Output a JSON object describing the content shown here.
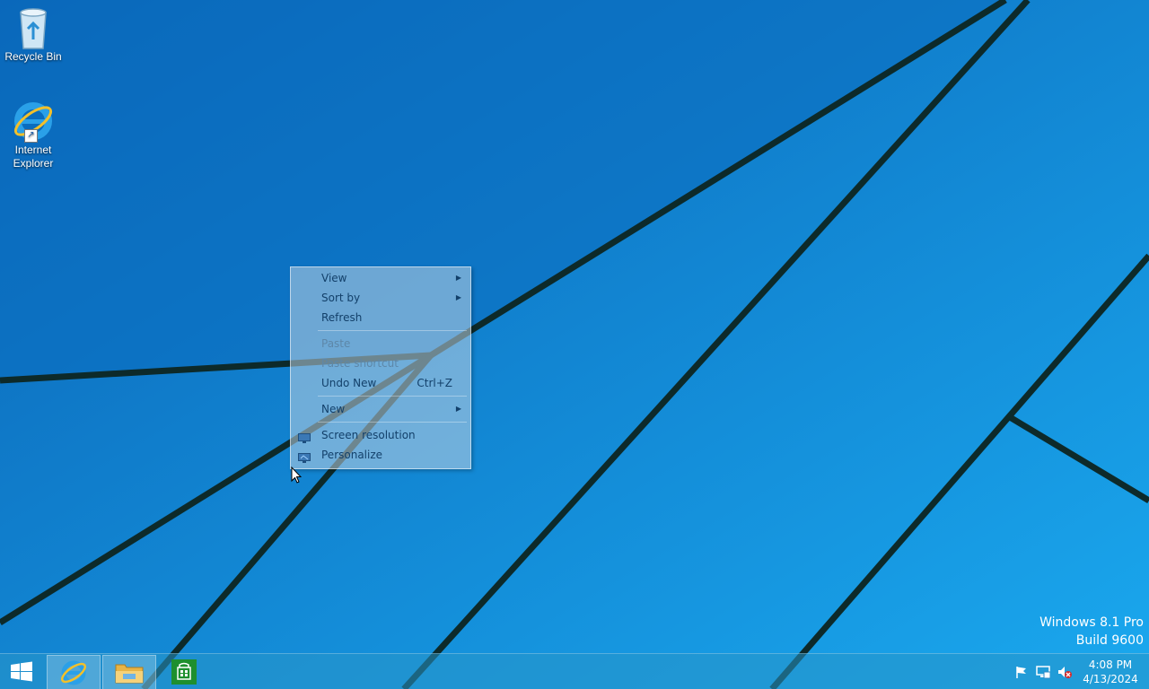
{
  "desktop": {
    "icons": [
      {
        "label": "Recycle Bin",
        "icon": "recycle-bin-icon"
      },
      {
        "label": "Internet Explorer",
        "icon": "internet-explorer-icon"
      }
    ],
    "watermark": {
      "line1": "Windows 8.1 Pro",
      "line2": "Build 9600"
    }
  },
  "context_menu": {
    "items": [
      {
        "label": "View",
        "submenu": true,
        "enabled": true
      },
      {
        "label": "Sort by",
        "submenu": true,
        "enabled": true
      },
      {
        "label": "Refresh",
        "enabled": true
      },
      {
        "label": "Paste",
        "enabled": false
      },
      {
        "label": "Paste shortcut",
        "enabled": false
      },
      {
        "label": "Undo New",
        "accelerator": "Ctrl+Z",
        "enabled": true
      },
      {
        "label": "New",
        "submenu": true,
        "enabled": true
      },
      {
        "label": "Screen resolution",
        "icon": "monitor-icon",
        "enabled": true
      },
      {
        "label": "Personalize",
        "icon": "personalize-icon",
        "enabled": true
      }
    ]
  },
  "taskbar": {
    "pinned": [
      {
        "name": "Internet Explorer",
        "icon": "internet-explorer-icon",
        "active": true
      },
      {
        "name": "File Explorer",
        "icon": "file-explorer-icon",
        "active": true
      },
      {
        "name": "Store",
        "icon": "store-icon",
        "active": false
      }
    ],
    "tray_icons": [
      "action-center-flag-icon",
      "network-icon",
      "volume-muted-icon"
    ],
    "clock": {
      "time": "4:08 PM",
      "date": "4/13/2024"
    }
  },
  "colors": {
    "accent": "#0d86d8",
    "menu_text": "#13406a",
    "store_green": "#1e8f2e"
  }
}
